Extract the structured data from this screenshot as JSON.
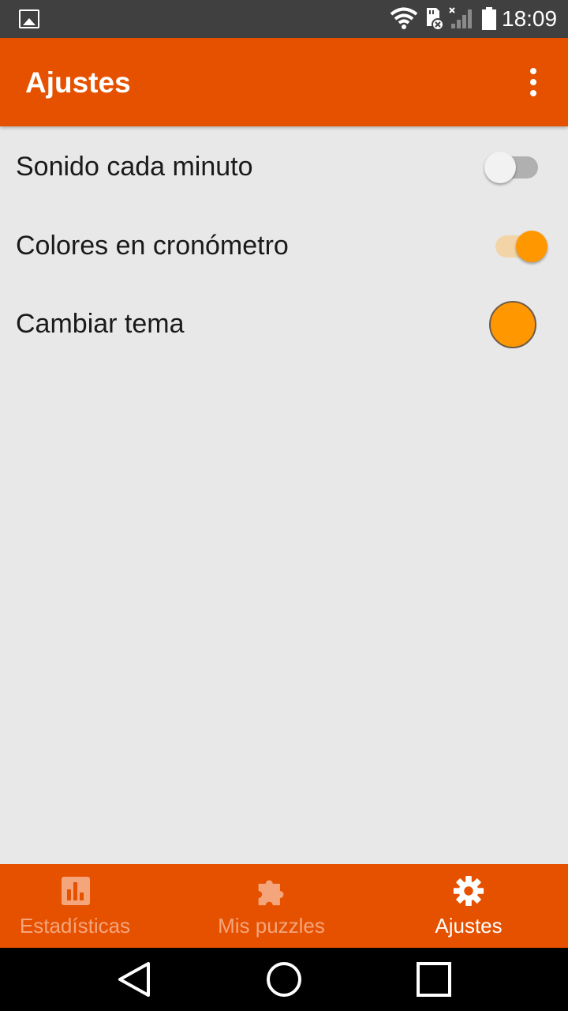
{
  "status_bar": {
    "time": "18:09",
    "icons": [
      "gallery-icon",
      "wifi-icon",
      "sd-card-icon",
      "signal-icon",
      "battery-icon"
    ]
  },
  "app_bar": {
    "title": "Ajustes",
    "menu_icon": "more-vert-icon"
  },
  "settings": {
    "items": [
      {
        "label": "Sonido cada minuto",
        "type": "switch",
        "checked": false
      },
      {
        "label": "Colores en cronómetro",
        "type": "switch",
        "checked": true
      },
      {
        "label": "Cambiar tema",
        "type": "color",
        "color": "#ff9800"
      }
    ]
  },
  "bottom_nav": {
    "items": [
      {
        "label": "Estadísticas",
        "icon": "bar-chart-icon",
        "active": false
      },
      {
        "label": "Mis puzzles",
        "icon": "puzzle-icon",
        "active": false
      },
      {
        "label": "Ajustes",
        "icon": "gear-icon",
        "active": true
      }
    ]
  },
  "colors": {
    "primary": "#e65100",
    "accent": "#ff9800",
    "background": "#e8e8e8",
    "status_bar": "#404040"
  },
  "system_nav": {
    "icons": [
      "back-icon",
      "home-icon",
      "recents-icon"
    ]
  }
}
